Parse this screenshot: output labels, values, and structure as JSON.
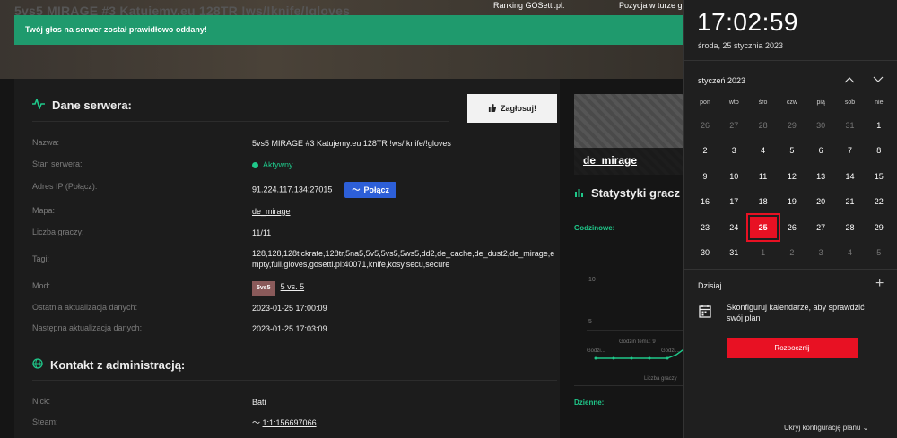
{
  "hero": {
    "title": "5vs5 MIRAGE #3 Katujemy.eu 128TR !ws/!knife/!gloves",
    "ranking_label": "Ranking GOSetti.pl:",
    "position_label": "Pozycja w turze g"
  },
  "toast": {
    "message": "Twój głos na serwer został prawidłowo oddany!"
  },
  "server": {
    "heading": "Dane serwera:",
    "vote_label": "Zagłosuj!",
    "rows": {
      "name": {
        "label": "Nazwa:",
        "value": "5vs5 MIRAGE #3 Katujemy.eu 128TR !ws/!knife/!gloves"
      },
      "status": {
        "label": "Stan serwera:",
        "value": "Aktywny"
      },
      "ip": {
        "label": "Adres IP (Połącz):",
        "value": "91.224.117.134:27015",
        "connect_label": "Połącz"
      },
      "map": {
        "label": "Mapa:",
        "value": "de_mirage"
      },
      "players": {
        "label": "Liczba graczy:",
        "value": "11/11"
      },
      "tags": {
        "label": "Tagi:",
        "value": "128,128,128tickrate,128tr,5na5,5v5,5vs5,5ws5,dd2,de_cache,de_dust2,de_mirage,empty,full,gloves,gosetti.pl:40071,knife,kosy,secu,secure"
      },
      "mod": {
        "label": "Mod:",
        "badge": "5vs5",
        "value": "5 vs. 5"
      },
      "last_update": {
        "label": "Ostatnia aktualizacja danych:",
        "value": "2023-01-25 17:00:09"
      },
      "next_update": {
        "label": "Następna aktualizacja danych:",
        "value": "2023-01-25 17:03:09"
      }
    }
  },
  "contact": {
    "heading": "Kontakt z administracją:",
    "nick_label": "Nick:",
    "nick_value": "Bati",
    "steam_label": "Steam:",
    "steam_value": "1:1:156697066"
  },
  "side": {
    "map_title": "de_mirage",
    "stats_heading": "Statystyki gracz",
    "hourly_label": "Godzinowe:",
    "daily_label": "Dzienne:",
    "tick_10": "10",
    "tick_5": "5",
    "hours_ago_label": "Godzin temu: 9",
    "godz_label_1": "Godzi...",
    "godz_label_2": "Godzi...",
    "players_axis": "Liczba graczy"
  },
  "panel": {
    "time": "17:02:59",
    "date": "środa, 25 stycznia 2023",
    "month": "styczeń 2023",
    "weekdays": [
      "pon",
      "wto",
      "śro",
      "czw",
      "pią",
      "sob",
      "nie"
    ],
    "today_label": "Dzisiaj",
    "plan_text": "Skonfiguruj kalendarze, aby sprawdzić swój plan",
    "start_label": "Rozpocznij",
    "hide_label": "Ukryj konfigurację planu",
    "days": [
      [
        "26",
        "27",
        "28",
        "29",
        "30",
        "31",
        "1"
      ],
      [
        "2",
        "3",
        "4",
        "5",
        "6",
        "7",
        "8"
      ],
      [
        "9",
        "10",
        "11",
        "12",
        "13",
        "14",
        "15"
      ],
      [
        "16",
        "17",
        "18",
        "19",
        "20",
        "21",
        "22"
      ],
      [
        "23",
        "24",
        "25",
        "26",
        "27",
        "28",
        "29"
      ],
      [
        "30",
        "31",
        "1",
        "2",
        "3",
        "4",
        "5"
      ]
    ],
    "today_day": "25"
  },
  "colors": {
    "accent_green": "#1fc88a",
    "toast_green": "#1f9a6d",
    "connect_blue": "#2d5fd8",
    "windows_red": "#e81123"
  }
}
